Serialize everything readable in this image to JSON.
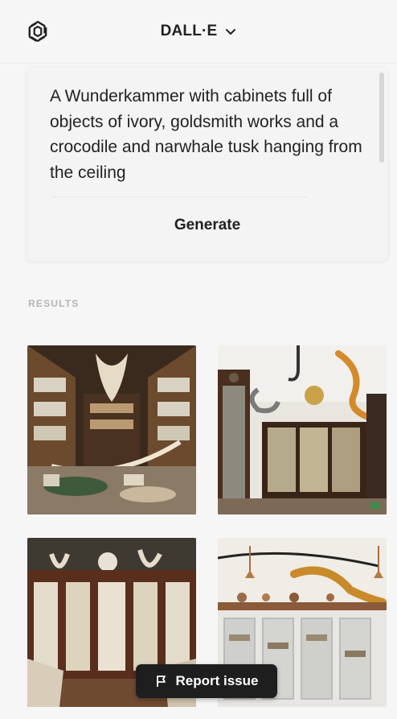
{
  "header": {
    "logo_icon": "openai-logo-icon",
    "title": "DALL·E",
    "dropdown_icon": "chevron-down-icon"
  },
  "prompt": {
    "text": "A Wunderkammer with cabinets full of objects of ivory, goldsmith works and a crocodile and narwhale tusk hanging from the ceiling",
    "generate_label": "Generate"
  },
  "results": {
    "label": "RESULTS",
    "images": [
      {
        "name": "result-image-1"
      },
      {
        "name": "result-image-2"
      },
      {
        "name": "result-image-3"
      },
      {
        "name": "result-image-4"
      }
    ]
  },
  "report": {
    "label": "Report issue",
    "icon": "flag-icon"
  }
}
